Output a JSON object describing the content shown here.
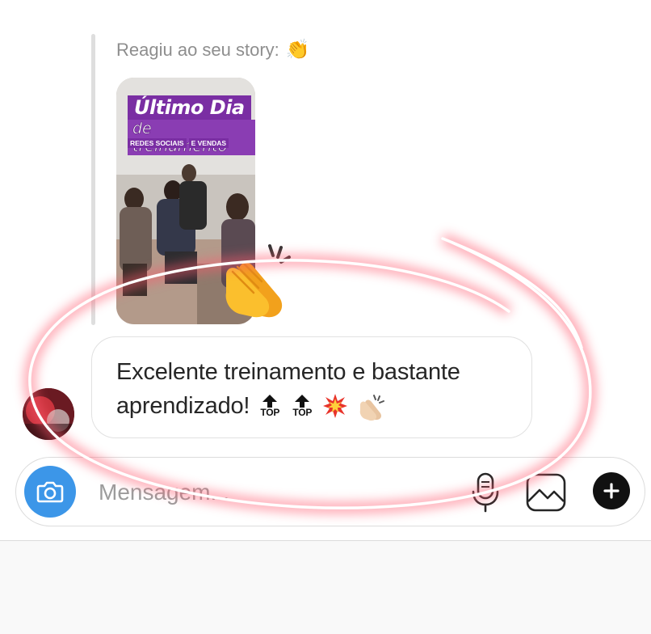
{
  "reaction": {
    "label": "Reagiu ao seu story:",
    "emoji": "👏"
  },
  "story": {
    "title_line1": "Último Dia",
    "title_line2": "de treinamento",
    "tag_1": "REDES SOCIAIS",
    "tag_2": "E VENDAS",
    "reaction_emoji": "clapping-hands"
  },
  "message": {
    "line1": "Excelente treinamento e bastante",
    "line2": "aprendizado!",
    "emojis": [
      "top-arrow",
      "top-arrow",
      "collision",
      "clapping-hands-light-skin"
    ],
    "top_label": "TOP"
  },
  "composer": {
    "placeholder": "Mensagem..."
  },
  "colors": {
    "camera": "#3c96e8",
    "highlight": "#ff5a6e",
    "story_purple": "#7a2ea3"
  }
}
